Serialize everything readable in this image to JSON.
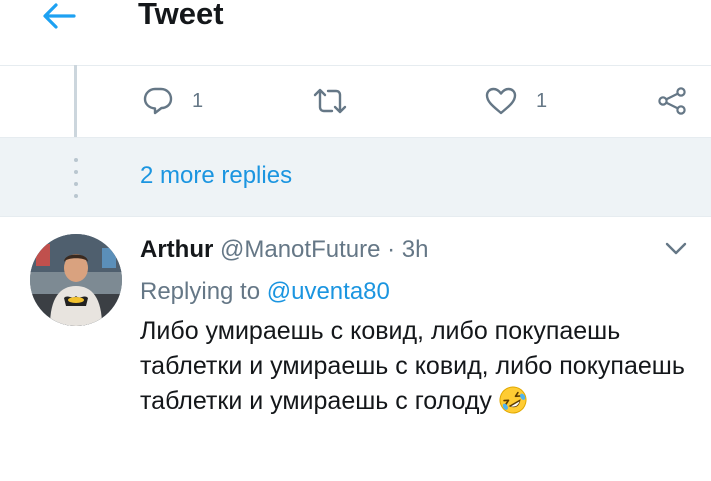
{
  "header": {
    "title": "Tweet",
    "back_icon": "arrow-left-icon",
    "accent": "#1da1f2"
  },
  "parent_actions": {
    "reply_count": "1",
    "retweet_count": "",
    "like_count": "1",
    "icons": [
      "reply-icon",
      "retweet-icon",
      "like-icon",
      "share-icon"
    ]
  },
  "more_replies": {
    "label": "2 more replies"
  },
  "reply": {
    "name": "Arthur",
    "handle": "@ManotFuture",
    "separator": "·",
    "time": "3h",
    "replying_prefix": "Replying to",
    "replying_to": "@uventa80",
    "text": "Либо умираешь с ковид, либо покупаешь таблетки и умираешь с ковид, либо покупаешь таблетки и умираешь с голоду",
    "emoji": "rolling-on-floor-laughing-icon"
  },
  "colors": {
    "link": "#1b95e0",
    "secondary": "#657786",
    "more_bg": "#eef3f6"
  }
}
